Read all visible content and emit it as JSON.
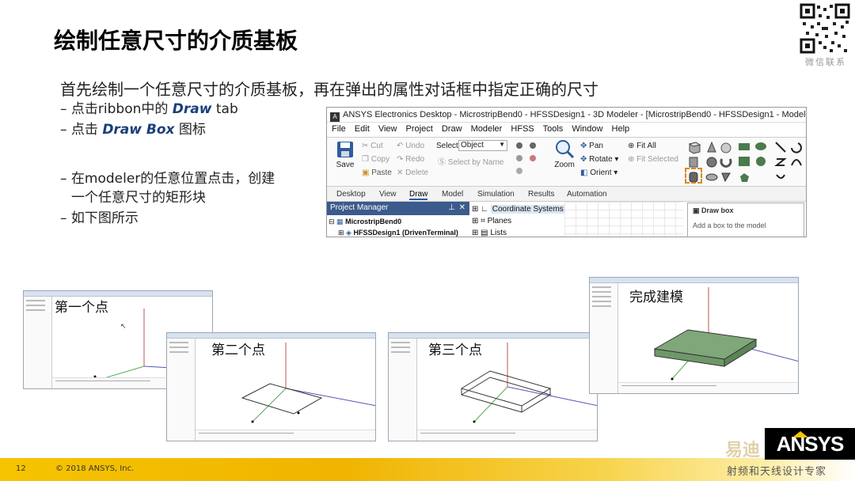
{
  "slide": {
    "title": "绘制任意尺寸的介质基板",
    "qr_caption": "微信联系",
    "intro": "首先绘制一个任意尺寸的介质基板，再在弹出的属性对话框中指定正确的尺寸",
    "bullets": {
      "b1_prefix": "– 点击ribbon中的 ",
      "b1_bold": "Draw",
      "b1_suffix": " tab",
      "b2_prefix": "– 点击 ",
      "b2_bold": "Draw Box",
      "b2_suffix": " 图标",
      "b3_line1": "– 在modeler的任意位置点击，创建",
      "b3_line2": "一个任意尺寸的矩形块",
      "b4": "– 如下图所示"
    },
    "page_number": "12",
    "copyright": "© 2018 ANSYS, Inc.",
    "logo_text": "ANSYS",
    "watermark_top": "易迪",
    "watermark_bottom": "射频和天线设计专家"
  },
  "ribbon": {
    "app_title": "ANSYS Electronics Desktop - MicrostripBend0 - HFSSDesign1 - 3D Modeler - [MicrostripBend0 - HFSSDesign1 - Modeler]",
    "menu": [
      "File",
      "Edit",
      "View",
      "Project",
      "Draw",
      "Modeler",
      "HFSS",
      "Tools",
      "Window",
      "Help"
    ],
    "save": "Save",
    "cut": "Cut",
    "copy": "Copy",
    "paste": "Paste",
    "undo": "Undo",
    "redo": "Redo",
    "delete": "Delete",
    "select_label": "Select:",
    "select_value": "Object",
    "select_by_name": "Select by Name",
    "zoom": "Zoom",
    "pan": "Pan",
    "rotate": "Rotate",
    "orient": "Orient",
    "fit_all": "Fit All",
    "fit_selected": "Fit Selected",
    "tabs": [
      "Desktop",
      "View",
      "Draw",
      "Model",
      "Simulation",
      "Results",
      "Automation"
    ],
    "active_tab": "Draw",
    "project_manager": "Project Manager",
    "pm_close": "✕",
    "pm_pin": "⊥",
    "project_name": "MicrostripBend0",
    "design_name": "HFSSDesign1 (DrivenTerminal)",
    "tree": [
      "Coordinate Systems",
      "Planes",
      "Lists"
    ],
    "tooltip_title": "Draw box",
    "tooltip_desc": "Add a box to the model"
  },
  "modelers": {
    "label1": "第一个点",
    "label2": "第二个点",
    "label3": "第三个点",
    "label4": "完成建模"
  },
  "colors": {
    "title": "#000000",
    "footer_yellow": "#f6c400",
    "tab_accent": "#2b579a",
    "box_fill": "#7fa77a",
    "highlight": "#d98a1b"
  }
}
